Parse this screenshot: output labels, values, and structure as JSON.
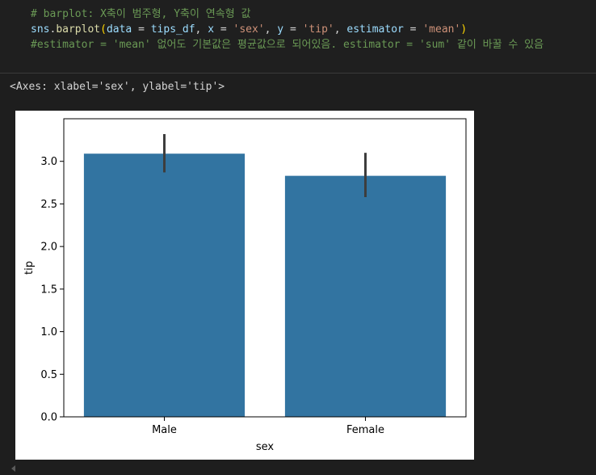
{
  "code_cell": {
    "line1": "# barplot: X축이 범주형, Y축이 연속형 값",
    "line2": {
      "module": "sns",
      "dot": ".",
      "func": "barplot",
      "open_paren": "(",
      "kw_data": "data",
      "eq1": " = ",
      "arg_data": "tips_df",
      "comma1": ", ",
      "kw_x": "x",
      "eq2": " = ",
      "arg_x": "'sex'",
      "comma2": ", ",
      "kw_y": "y",
      "eq3": " = ",
      "arg_y": "'tip'",
      "comma3": ", ",
      "kw_est": "estimator",
      "eq4": " = ",
      "arg_est": "'mean'",
      "close_paren": ")"
    },
    "line3": "#estimator = 'mean' 없어도 기본값은 평균값으로 되어있음. estimator = 'sum' 같이 바꿀 수 있음"
  },
  "output": {
    "repr": "<Axes: xlabel='sex', ylabel='tip'>"
  },
  "chart_data": {
    "type": "bar",
    "categories": [
      "Male",
      "Female"
    ],
    "values": [
      3.09,
      2.83
    ],
    "error_low": [
      2.87,
      2.58
    ],
    "error_high": [
      3.32,
      3.1
    ],
    "xlabel": "sex",
    "ylabel": "tip",
    "ylim": [
      0,
      3.5
    ],
    "yticks": [
      0.0,
      0.5,
      1.0,
      1.5,
      2.0,
      2.5,
      3.0
    ],
    "ytick_labels": [
      "0.0",
      "0.5",
      "1.0",
      "1.5",
      "2.0",
      "2.5",
      "3.0"
    ],
    "bar_color": "#3274a1",
    "errbar_color": "#3d3d3d",
    "grid": false
  }
}
